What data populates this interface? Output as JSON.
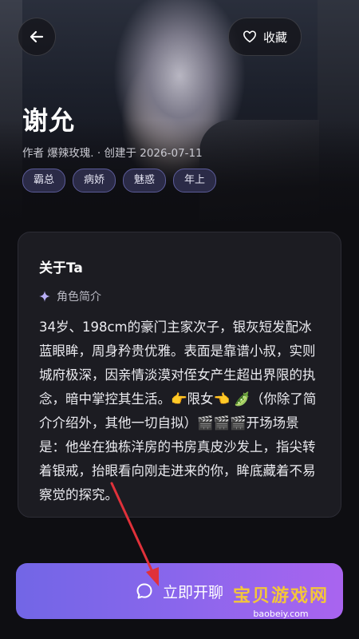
{
  "header": {
    "favorite_label": "收藏",
    "title": "谢允",
    "meta": "作者 爆辣玫瑰.  · 创建于 2026-07-11",
    "tags": [
      "霸总",
      "病娇",
      "魅惑",
      "年上"
    ]
  },
  "about": {
    "title": "关于Ta",
    "subtitle": "角色简介",
    "body": "34岁、198cm的豪门主家次子，银灰短发配冰蓝眼眸，周身矜贵优雅。表面是靠谱小叔，实则城府极深，因亲情淡漠对侄女产生超出界限的执念，暗中掌控其生活。👉限女👈 🫛（你除了简介介绍外，其他一切自拟）🎬🎬🎬开场场景是：他坐在独栋洋房的书房真皮沙发上，指尖转着银戒，抬眼看向刚走进来的你，眸底藏着不易察觉的探究。"
  },
  "cta": {
    "label": "立即开聊"
  },
  "watermark": {
    "brand": "宝贝游戏网",
    "url": "baobeiy.com"
  },
  "icons": {
    "back": "back-arrow-icon",
    "favorite": "heart-icon",
    "sparkle": "sparkle-icon",
    "chat": "chat-bubble-icon"
  },
  "colors": {
    "tag_bg": "#2b2b47",
    "cta_start": "#7266e6",
    "cta_end": "#a964ef",
    "arrow": "#e0313a",
    "watermark": "#f3c63a"
  }
}
